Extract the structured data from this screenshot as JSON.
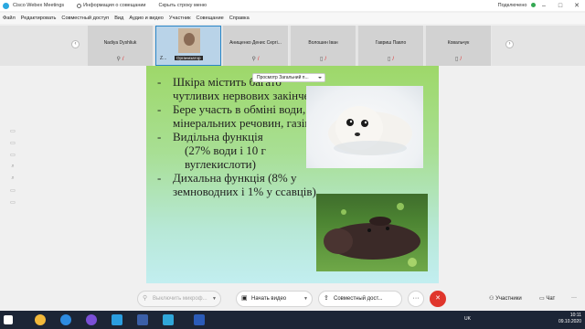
{
  "window": {
    "app_title": "Cisco Webex Meetings",
    "meeting_info": "Информация о совещании",
    "hide_menu": "Скрыть строку меню",
    "connection": "Подключено",
    "minimize": "–",
    "maximize": "□",
    "close": "✕"
  },
  "menu": [
    "Файл",
    "Редактировать",
    "Совместный доступ",
    "Вид",
    "Аудио и видео",
    "Участник",
    "Совещание",
    "Справка"
  ],
  "participants": {
    "prev": "‹",
    "next": "›",
    "self": {
      "name": "Z...",
      "badge": "Организатор"
    },
    "tiles": [
      {
        "name": "Nadiya Dyshliuk"
      },
      {
        "name": "Анищенко Денис Сергі..."
      },
      {
        "name": "Волошин Іван"
      },
      {
        "name": "Гавриш Павло"
      },
      {
        "name": "Ковальчук"
      }
    ]
  },
  "share_label": "Просмотр Загальний п...",
  "side_tools": [
    "▭",
    "▭",
    "▭",
    "⌕",
    "⌕",
    "▭",
    "▭"
  ],
  "slide": {
    "bullets": [
      {
        "text": "Шкіра містить багато чутливих нервових закінчень"
      },
      {
        "text": "Бере участь в обміні води, мінеральних речовин, газів"
      },
      {
        "text": "Видільна функція"
      }
    ],
    "excretory_detail": "(27% води і 10 г вуглекислоти)",
    "last_bullet": "Дихальна функція (8% у земноводних і 1% у ссавців)"
  },
  "controls": {
    "mute": "Выключить микроф...",
    "video": "Начать видео",
    "share": "Совместный дост...",
    "more": "···",
    "leave": "✕",
    "participants": "Участники",
    "chat": "Чат",
    "more_right": "···"
  },
  "taskbar": {
    "lang": "UK",
    "time": "10:11",
    "date": "09.10.2020"
  }
}
